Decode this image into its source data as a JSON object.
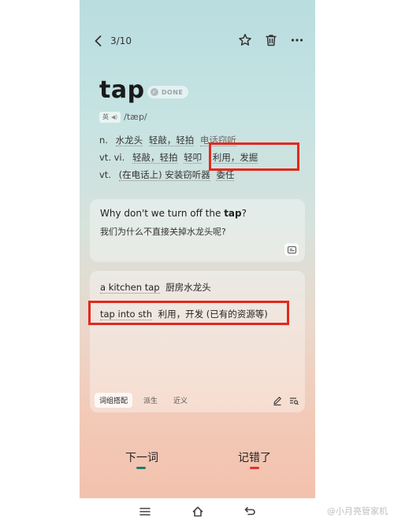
{
  "header": {
    "counter": "3/10"
  },
  "word": {
    "text": "tap",
    "status": "DONE",
    "accent": "英",
    "phonetic": "/tæp/"
  },
  "definitions": {
    "line1": {
      "pos": "n.",
      "m1": "水龙头",
      "m2": "轻敲，轻拍",
      "m3": "电话窃听"
    },
    "line2": {
      "pos": "vt. vi.",
      "m1": "轻敲，轻拍",
      "m2": "轻叩",
      "m3": "利用，发掘"
    },
    "line3": {
      "pos": "vt.",
      "m1": "(在电话上) 安装窃听器",
      "m2": "委任"
    }
  },
  "example": {
    "en_before": "Why don't we turn off the",
    "en_word": "tap",
    "en_after": "?",
    "zh": "我们为什么不直接关掉水龙头呢?"
  },
  "phrases": [
    {
      "en": "a kitchen tap",
      "zh": "厨房水龙头"
    },
    {
      "en": "tap into sth",
      "zh": "利用，开发 (已有的资源等)"
    }
  ],
  "tabs": [
    "词组搭配",
    "派生",
    "近义"
  ],
  "bottom": {
    "next": "下一词",
    "wrong": "记错了"
  },
  "watermark": "@小月亮管家机",
  "colors": {
    "highlight_box": "#e3281c",
    "next_indicator": "#1b7f6b",
    "wrong_indicator": "#e0332c"
  }
}
